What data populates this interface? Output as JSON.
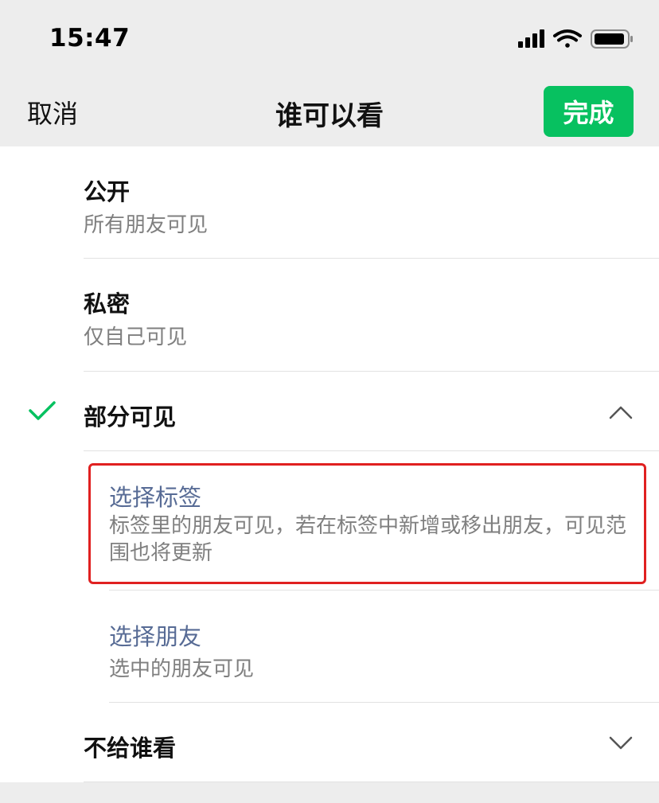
{
  "status_bar": {
    "time": "15:47"
  },
  "nav": {
    "cancel_label": "取消",
    "title": "谁可以看",
    "done_label": "完成"
  },
  "options": [
    {
      "title": "公开",
      "desc": "所有朋友可见"
    },
    {
      "title": "私密",
      "desc": "仅自己可见"
    },
    {
      "title": "部分可见",
      "selected": true,
      "expanded": true,
      "sub_options": [
        {
          "title": "选择标签",
          "desc": "标签里的朋友可见，若在标签中新增或移出朋友，可见范围也将更新"
        },
        {
          "title": "选择朋友",
          "desc": "选中的朋友可见"
        }
      ]
    },
    {
      "title": "不给谁看",
      "expanded": false
    }
  ],
  "colors": {
    "accent_green": "#07c160",
    "link_blue": "#576b95",
    "highlight_red": "#e02020"
  }
}
